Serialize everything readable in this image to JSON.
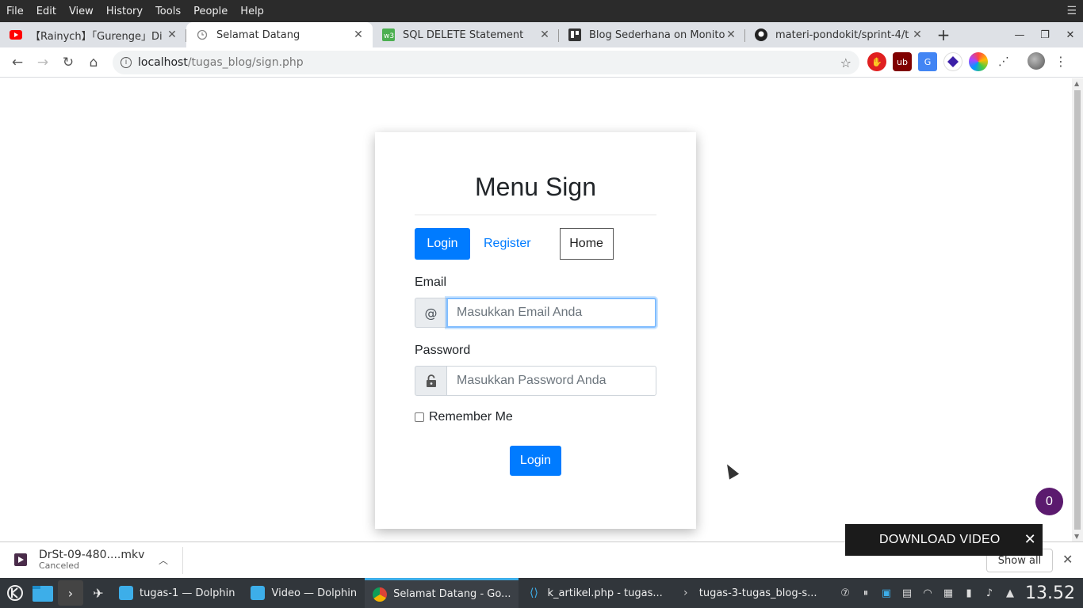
{
  "menubar": {
    "items": [
      "File",
      "Edit",
      "View",
      "History",
      "Tools",
      "People",
      "Help"
    ]
  },
  "tabs": [
    {
      "title": "【Rainych】「Gurenge」Di",
      "icon": "youtube-icon",
      "active": false
    },
    {
      "title": "Selamat Datang",
      "icon": "loading-icon",
      "active": true
    },
    {
      "title": "SQL DELETE Statement",
      "icon": "w3schools-icon",
      "active": false
    },
    {
      "title": "Blog Sederhana on Monito",
      "icon": "trello-icon",
      "active": false
    },
    {
      "title": "materi-pondokit/sprint-4/t",
      "icon": "github-icon",
      "active": false
    }
  ],
  "toolbar": {
    "url_host": "localhost",
    "url_path": "/tugas_blog/sign.php"
  },
  "form": {
    "title": "Menu Sign",
    "tab_login": "Login",
    "tab_register": "Register",
    "home": "Home",
    "email_label": "Email",
    "email_prefix": "@",
    "email_placeholder": "Masukkan Email Anda",
    "password_label": "Password",
    "password_placeholder": "Masukkan Password Anda",
    "remember": "Remember Me",
    "submit": "Login"
  },
  "badge": {
    "count": "0"
  },
  "download_video": {
    "label": "DOWNLOAD VIDEO"
  },
  "download_shelf": {
    "filename": "DrSt-09-480....mkv",
    "status": "Canceled",
    "show_all": "Show all"
  },
  "taskbar": {
    "tasks": [
      {
        "label": "tugas-1 — Dolphin",
        "icon": "folder-icon"
      },
      {
        "label": "Video — Dolphin",
        "icon": "folder-icon"
      },
      {
        "label": "Selamat Datang - Go...",
        "icon": "chrome-icon",
        "active": true
      },
      {
        "label": "k_artikel.php - tugas...",
        "icon": "vscode-icon"
      },
      {
        "label": "tugas-3-tugas_blog-s...",
        "icon": "terminal-icon"
      }
    ],
    "clock": "13.52"
  },
  "colors": {
    "primary": "#007bff",
    "badge": "#5b1a6e",
    "taskbar": "#31363b"
  }
}
